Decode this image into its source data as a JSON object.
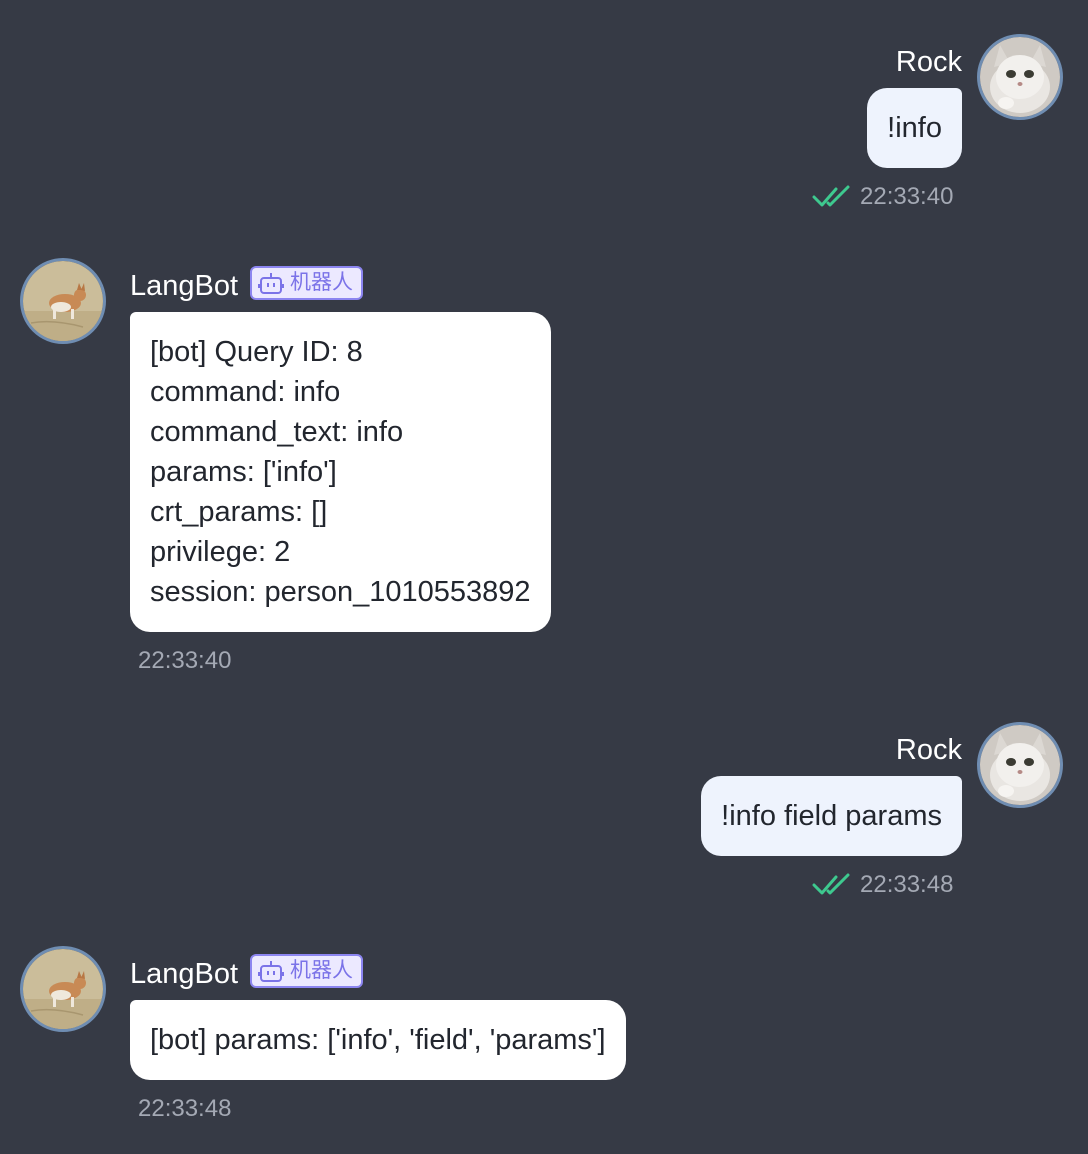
{
  "messages": [
    {
      "sender": "Rock",
      "text": "!info",
      "time": "22:33:40"
    },
    {
      "sender": "LangBot",
      "badge": "机器人",
      "lines": [
        "[bot] Query ID: 8",
        "command: info",
        "command_text: info",
        "params: ['info']",
        "crt_params: []",
        "privilege: 2",
        "session: person_1010553892"
      ],
      "time": "22:33:40"
    },
    {
      "sender": "Rock",
      "text": "!info field params",
      "time": "22:33:48"
    },
    {
      "sender": "LangBot",
      "badge": "机器人",
      "text": "[bot] params: ['info', 'field', 'params']",
      "time": "22:33:48"
    }
  ],
  "colors": {
    "background": "#363a45",
    "user_bubble": "#eef3fd",
    "bot_bubble": "#ffffff",
    "read_check": "#3ec98f",
    "badge_accent": "#7b73e8"
  },
  "icons": {
    "user_avatar": "cat-photo",
    "bot_avatar": "corgi-photo",
    "badge_icon": "robot-icon",
    "read_receipt": "double-check-icon"
  }
}
